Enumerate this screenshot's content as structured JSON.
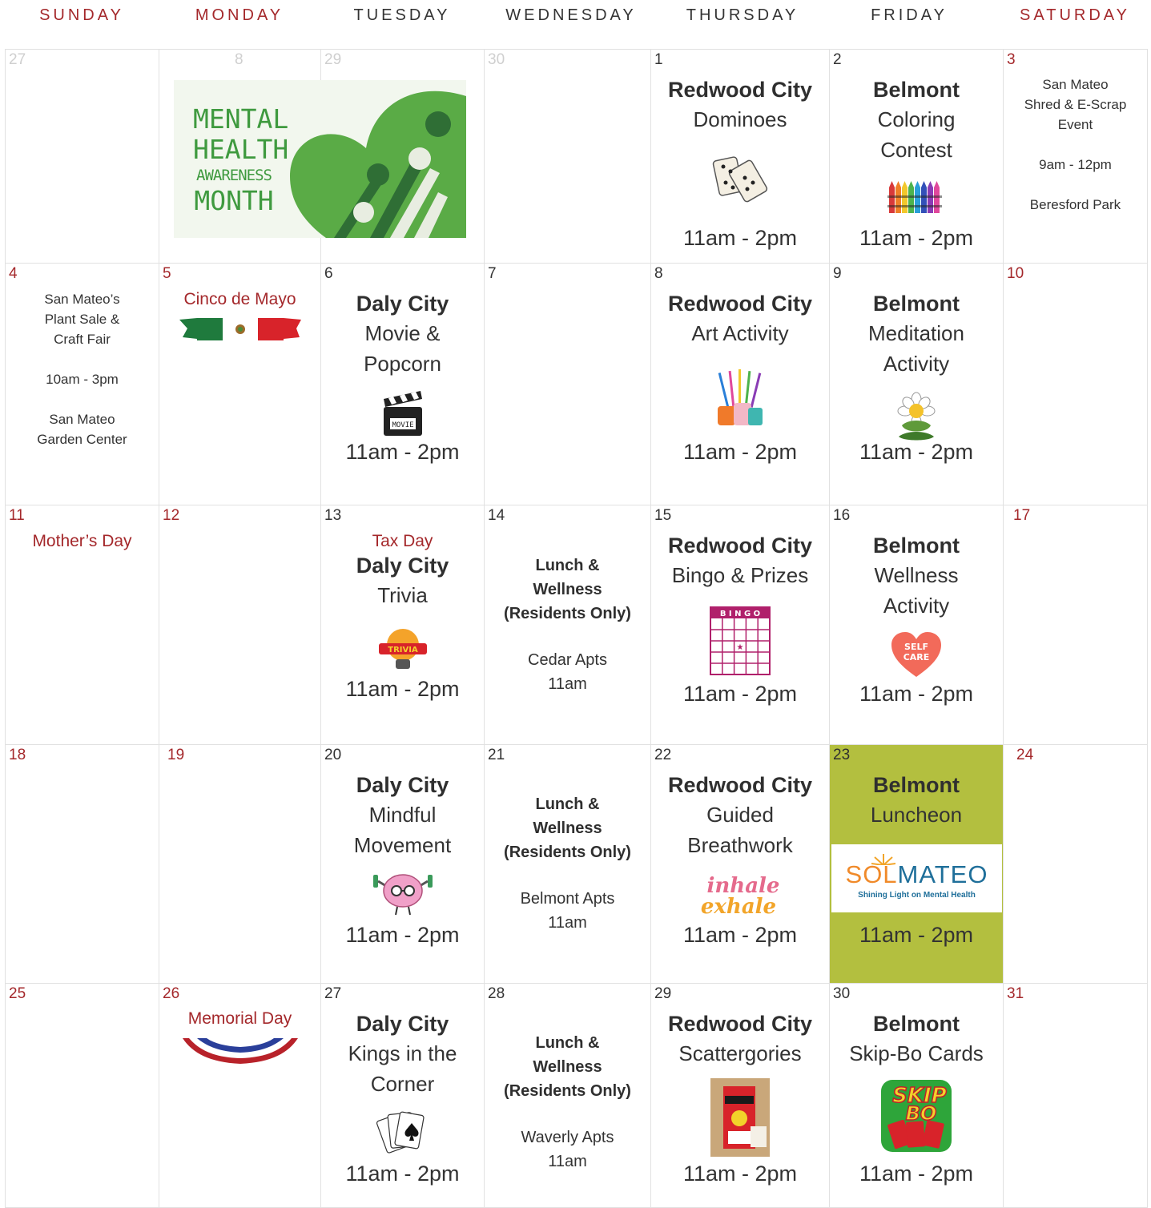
{
  "weekdays": [
    "SUNDAY",
    "MONDAY",
    "TUESDAY",
    "WEDNESDAY",
    "THURSDAY",
    "FRIDAY",
    "SATURDAY"
  ],
  "banner": {
    "line1": "MENTAL",
    "line2": "HEALTH",
    "line3": "AWARENESS",
    "line4": "MONTH"
  },
  "days": {
    "d27a": "27",
    "d8a": "8",
    "d29a": "29",
    "d30a": "30",
    "d1": "1",
    "d2": "2",
    "d3": "3",
    "d4": "4",
    "d5": "5",
    "d6": "6",
    "d7": "7",
    "d8": "8",
    "d9": "9",
    "d10": "10",
    "d11": "11",
    "d12": "12",
    "d13": "13",
    "d14": "14",
    "d15": "15",
    "d16": "16",
    "d17": "17",
    "d18": "18",
    "d19": "19",
    "d20": "20",
    "d21": "21",
    "d22": "22",
    "d23": "23",
    "d24": "24",
    "d25": "25",
    "d26": "26",
    "d27": "27",
    "d28": "28",
    "d29": "29",
    "d30": "30",
    "d31": "31"
  },
  "cities": {
    "redwood": "Redwood City",
    "belmont": "Belmont",
    "daly": "Daly City"
  },
  "events": {
    "e1": "Dominoes",
    "e2a": "Coloring",
    "e2b": "Contest",
    "e3a": "San Mateo",
    "e3b": "Shred & E-Scrap",
    "e3c": "Event",
    "e3time": "9am - 12pm",
    "e3place": "Beresford Park",
    "e4a": "San Mateo’s",
    "e4b": "Plant Sale &",
    "e4c": "Craft Fair",
    "e4time": "10am - 3pm",
    "e4place1": "San Mateo",
    "e4place2": "Garden Center",
    "e5": "Cinco de Mayo",
    "e6a": "Movie &",
    "e6b": "Popcorn",
    "e8": "Art Activity",
    "e9a": "Meditation",
    "e9b": "Activity",
    "e11": "Mother’s Day",
    "e13hol": "Tax Day",
    "e13": "Trivia",
    "lunch1": "Lunch &",
    "lunch2": "Wellness",
    "lunch3": "(Residents Only)",
    "e14place": "Cedar Apts",
    "lunchtime": "11am",
    "e15": "Bingo & Prizes",
    "bingo": "B I N G O",
    "e16a": "Wellness",
    "e16b": "Activity",
    "selfcare1": "SELF",
    "selfcare2": "CARE",
    "e20a": "Mindful",
    "e20b": "Movement",
    "e21place": "Belmont Apts",
    "e22a": "Guided",
    "e22b": "Breathwork",
    "inhale": "inhale",
    "exhale": "exhale",
    "e23": "Luncheon",
    "sol1": "SOL",
    "sol2": "MATEO",
    "soltag": "Shining Light on Mental Health",
    "e26": "Memorial Day",
    "e27a": "Kings in the",
    "e27b": "Corner",
    "e28place": "Waverly Apts",
    "e29": "Scattergories",
    "e30": "Skip-Bo Cards",
    "skipbo1": "SKIP",
    "skipbo2": "BO",
    "movie": "MOVIE",
    "trivia": "TRIVIA"
  },
  "time": "11am - 2pm",
  "colors": {
    "holiday_red": "#a4282b",
    "highlight": "#b3bf3f",
    "banner_green": "#5aab46"
  }
}
